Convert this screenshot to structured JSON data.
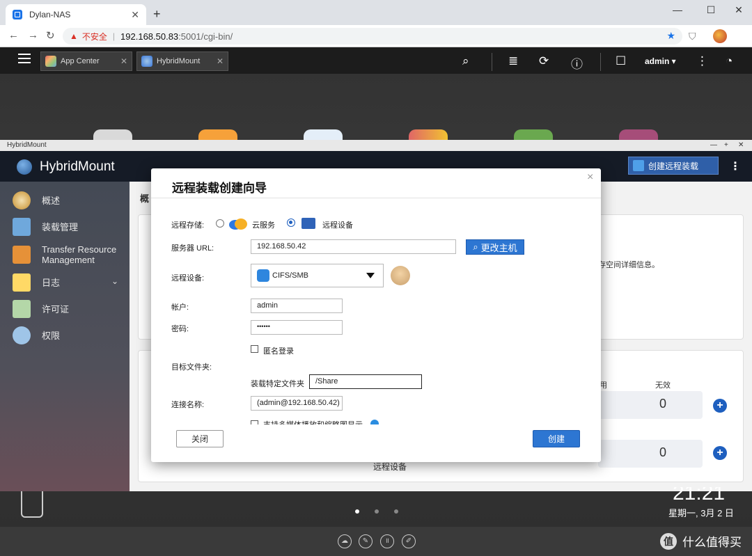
{
  "browser": {
    "tab_title": "Dylan-NAS",
    "tab_close": "✕",
    "new_tab": "+",
    "win_min": "—",
    "win_max": "☐",
    "win_close": "✕",
    "back": "←",
    "forward": "→",
    "reload": "↻",
    "warn_icon": "▲",
    "insecure_label": "不安全",
    "separator": "|",
    "url_host": "192.168.50.83",
    "url_rest": ":5001/cgi-bin/",
    "star": "★",
    "shield": "⛉"
  },
  "qts_bar": {
    "tabs": [
      {
        "label": "App Center",
        "close": "✕",
        "color": "#e06666"
      },
      {
        "label": "HybridMount",
        "close": "✕",
        "color": "#3c78d8"
      }
    ],
    "search_icon": "⌕",
    "stack_icon": "≣",
    "sync_icon": "⟳",
    "info_icon": "ⓘ",
    "user_icon": "☐",
    "user_label": "admin ▾",
    "more_icon": "⋮",
    "gauge_icon": "◔"
  },
  "window": {
    "title": "HybridMount",
    "min": "—",
    "max": "+",
    "close": "✕",
    "app_name": "HybridMount",
    "create_button": "创建远程装载",
    "kebab": "⋮"
  },
  "sidebar": {
    "items": [
      {
        "label": "概述",
        "color": "#d9a441"
      },
      {
        "label": "装载管理",
        "color": "#6fa8dc"
      },
      {
        "label": "Transfer Resource\nManagement",
        "color": "#e69138"
      },
      {
        "label": "日志",
        "color": "#ffd966"
      },
      {
        "label": "许可证",
        "color": "#b4d7a8"
      },
      {
        "label": "权限",
        "color": "#9fc5e8"
      }
    ],
    "expand_arrow": "⌄"
  },
  "content": {
    "overview_heading_cut": "概",
    "storage_text_cut": "存空间详细信息。",
    "col_header_cut": "用",
    "col_header_invalid": "无效",
    "stat_value_1": "0",
    "stat_value_2": "0",
    "plus": "+",
    "remote_device_label": "远程设备"
  },
  "dialog": {
    "title": "远程装载创建向导",
    "close": "×",
    "remote_storage_label": "远程存储:",
    "option_cloud": "云服务",
    "option_device": "远程设备",
    "server_url_label": "服务器 URL:",
    "server_url_value": "192.168.50.42",
    "change_host_button": "更改主机",
    "change_host_icon": "⌕",
    "remote_device_label": "远程设备:",
    "protocol_value": "CIFS/SMB",
    "account_label": "帐户:",
    "account_value": "admin",
    "password_label": "密码:",
    "password_value": "••••••",
    "anonymous_label": "匿名登录",
    "target_folder_label": "目标文件夹:",
    "mount_folder_label": "装载特定文件夹",
    "mount_folder_value": "/Share",
    "connection_name_label": "连接名称:",
    "connection_name_value": "(admin@192.168.50.42)",
    "cut_checkbox_text": "支持多媒体播放和缩略图显示",
    "cancel_button": "关闭",
    "create_button": "创建"
  },
  "dock": {
    "time": "21:21",
    "date": "星期一, 3月 2 日",
    "watermark_logo": "值",
    "watermark_text": "什么值得买"
  }
}
